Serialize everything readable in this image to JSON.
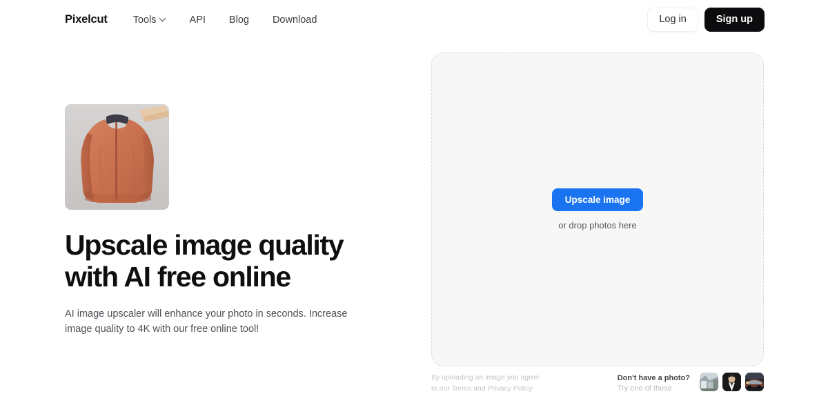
{
  "brand": {
    "name": "Pixelcut"
  },
  "nav": {
    "links": [
      {
        "label": "Tools",
        "icon": "chevron-down-icon",
        "has_dropdown": true
      },
      {
        "label": "API",
        "has_dropdown": false
      },
      {
        "label": "Blog",
        "has_dropdown": false
      },
      {
        "label": "Download",
        "has_dropdown": false
      }
    ],
    "login_label": "Log in",
    "signup_label": "Sign up"
  },
  "hero": {
    "title": "Upscale image quality with AI free online",
    "subtitle": "AI image upscaler will enhance your photo in seconds. Increase image quality to 4K with our free online tool!",
    "image_alt": "Orange bomber jacket on a hanger"
  },
  "upload": {
    "button_label": "Upscale image",
    "drop_hint": "or drop photos here"
  },
  "footer": {
    "terms_line1": "By uploading an image you agree",
    "terms_line2_prefix": "to our ",
    "terms_link": "Terms",
    "terms_line2_mid": " and ",
    "privacy_link": "Privacy Policy",
    "samples_title": "Don't have a photo?",
    "samples_sub": "Try one of these",
    "samples": [
      {
        "alt": "City street sample photo"
      },
      {
        "alt": "Portrait of a man in a suit sample photo"
      },
      {
        "alt": "Car at night sample photo"
      }
    ]
  },
  "colors": {
    "accent_blue": "#1a74f2",
    "signup_black": "#0c0c0e",
    "dropzone_bg": "#f7f7f8",
    "dropzone_border": "#dcdcde",
    "text_primary": "#0e0f11",
    "text_secondary": "#4d5156",
    "text_muted": "#c2c5c9"
  }
}
